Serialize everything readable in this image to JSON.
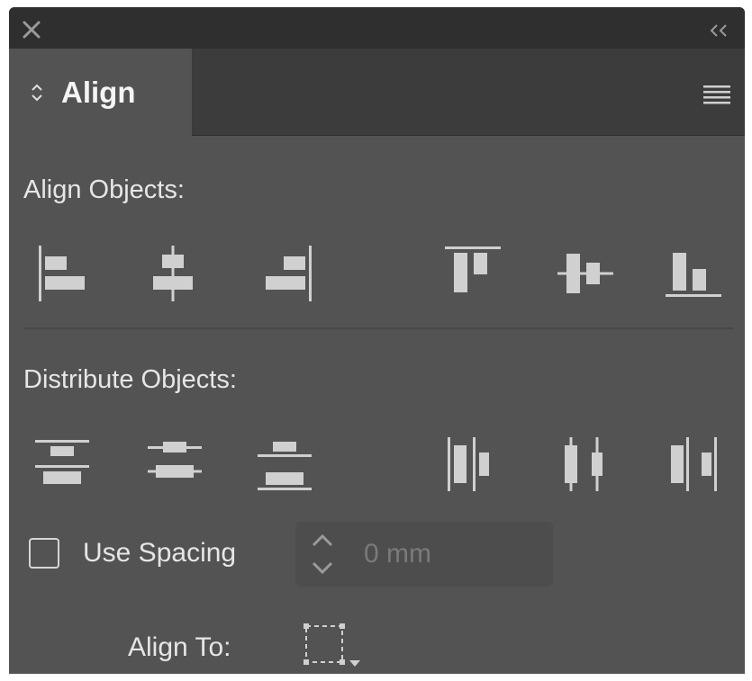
{
  "panel": {
    "tab_label": "Align",
    "icons": {
      "close": "close-icon",
      "collapse": "double-chevron-left-icon",
      "tab_sort": "up-down-arrows-icon",
      "menu": "hamburger-menu-icon"
    }
  },
  "align_objects": {
    "label": "Align Objects:",
    "buttons": [
      "align-left-edges-icon",
      "align-horizontal-centers-icon",
      "align-right-edges-icon",
      "align-top-edges-icon",
      "align-vertical-centers-icon",
      "align-bottom-edges-icon"
    ]
  },
  "distribute_objects": {
    "label": "Distribute Objects:",
    "buttons": [
      "distribute-top-edges-icon",
      "distribute-vertical-centers-icon",
      "distribute-bottom-edges-icon",
      "distribute-left-edges-icon",
      "distribute-horizontal-centers-icon",
      "distribute-right-edges-icon"
    ]
  },
  "use_spacing": {
    "label": "Use Spacing",
    "checked": false,
    "value": "0 mm"
  },
  "align_to": {
    "label": "Align To:",
    "icon": "align-to-selection-icon"
  },
  "colors": {
    "panel_bg": "#535353",
    "titlebar_bg": "#2f2f2f",
    "icon_fill": "#d0d0d0",
    "text": "#e6e6e6"
  }
}
